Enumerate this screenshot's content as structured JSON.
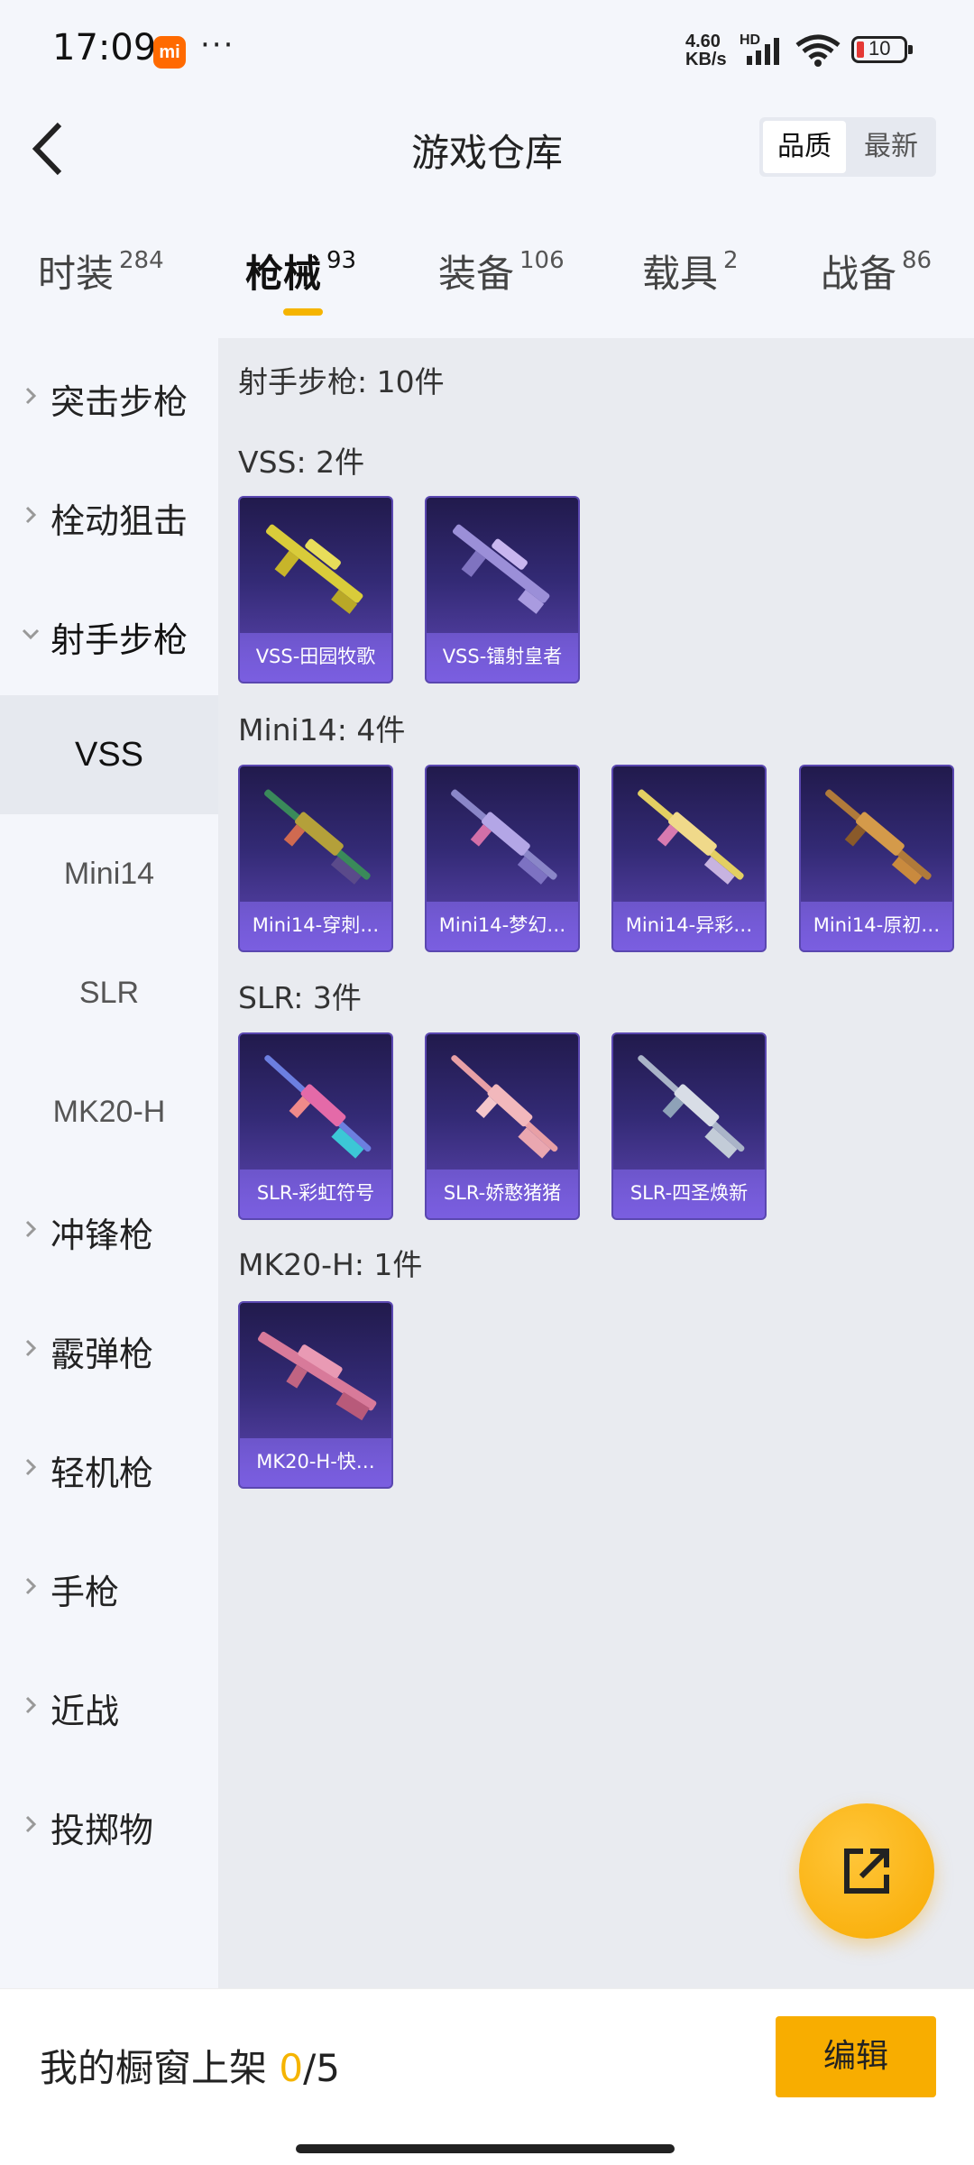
{
  "status_bar": {
    "time": "17:09",
    "mi_logo": "mi",
    "dots": "···",
    "net_speed": "4.60",
    "net_unit": "KB/s",
    "hd": "HD",
    "battery": "10"
  },
  "header": {
    "title": "游戏仓库",
    "sort_options": [
      "品质",
      "最新"
    ]
  },
  "tabs": [
    {
      "label": "时装",
      "count": "284"
    },
    {
      "label": "枪械",
      "count": "93"
    },
    {
      "label": "装备",
      "count": "106"
    },
    {
      "label": "载具",
      "count": "2"
    },
    {
      "label": "战备",
      "count": "86"
    }
  ],
  "sidebar": {
    "categories_top": [
      "突击步枪",
      "栓动狙击",
      "射手步枪"
    ],
    "subcategories": [
      "VSS",
      "Mini14",
      "SLR",
      "MK20-H"
    ],
    "categories_bottom": [
      "冲锋枪",
      "霰弹枪",
      "轻机枪",
      "手枪",
      "近战",
      "投掷物"
    ]
  },
  "content": {
    "header": "射手步枪: 10件",
    "sections": [
      {
        "title": "VSS: 2件",
        "items": [
          "VSS-田园牧歌",
          "VSS-镭射皇者"
        ]
      },
      {
        "title": "Mini14: 4件",
        "items": [
          "Mini14-穿刺…",
          "Mini14-梦幻…",
          "Mini14-异彩…",
          "Mini14-原初…"
        ]
      },
      {
        "title": "SLR: 3件",
        "items": [
          "SLR-彩虹符号",
          "SLR-娇憨猪猪",
          "SLR-四圣焕新"
        ]
      },
      {
        "title": "MK20-H: 1件",
        "items": [
          "MK20-H-快…"
        ]
      }
    ]
  },
  "bottom": {
    "label": "我的橱窗上架",
    "current": "0",
    "total": "/5",
    "edit_label": "编辑"
  },
  "icons": {
    "back": "chevron-left-icon",
    "fab": "share-icon"
  },
  "colors": {
    "accent": "#f5b400",
    "card_bg": "#332a75"
  }
}
